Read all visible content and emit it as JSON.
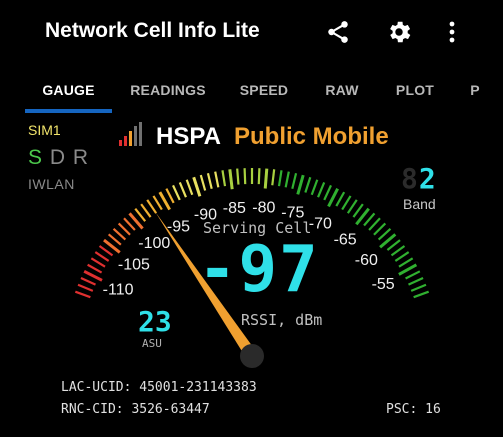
{
  "app": {
    "title": "Network Cell Info Lite"
  },
  "icons": {
    "share": "share-icon",
    "settings": "gear-icon",
    "more": "more-vert-icon",
    "signal": "signal-bars-icon"
  },
  "tabs": [
    {
      "label": "GAUGE",
      "active": true
    },
    {
      "label": "READINGS"
    },
    {
      "label": "SPEED"
    },
    {
      "label": "RAW"
    },
    {
      "label": "PLOT"
    },
    {
      "label": "P"
    }
  ],
  "sim": {
    "label": "SIM1",
    "mode_active": "S",
    "mode_inactive": "D R",
    "iwlan": "IWLAN"
  },
  "network": {
    "technology": "HSPA",
    "operator": "Public Mobile"
  },
  "band": {
    "value": "2",
    "ghost": "8",
    "label": "Band"
  },
  "gauge": {
    "serving_label": "Serving Cell",
    "value_text": "-97",
    "unit_label": "RSSI, dBm",
    "asu_value": "23",
    "asu_label": "ASU",
    "value": -97,
    "min": -113,
    "max": -51,
    "tick_labels": [
      {
        "text": "-110",
        "value": -110
      },
      {
        "text": "-105",
        "value": -105
      },
      {
        "text": "-100",
        "value": -100
      },
      {
        "text": "-95",
        "value": -95
      },
      {
        "text": "-90",
        "value": -90
      },
      {
        "text": "-85",
        "value": -85
      },
      {
        "text": "-80",
        "value": -80
      },
      {
        "text": "-75",
        "value": -75
      },
      {
        "text": "-70",
        "value": -70
      },
      {
        "text": "-65",
        "value": -65
      },
      {
        "text": "-60",
        "value": -60
      },
      {
        "text": "-55",
        "value": -55
      }
    ]
  },
  "colors": {
    "accent": "#2fe0e8",
    "operator": "#f0a030",
    "needle": "#f0a030",
    "tab_indicator": "#1565c0"
  },
  "footer": {
    "lac_ucid": "LAC-UCID: 45001-231143383",
    "rnc_cid": "RNC-CID: 3526-63447",
    "psc": "PSC: 16"
  }
}
